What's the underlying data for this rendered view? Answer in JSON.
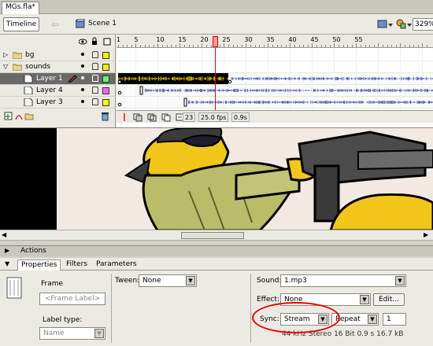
{
  "document_tab": "MGs.fla*",
  "toolbar": {
    "timeline_label": "Timeline",
    "scene_label": "Scene 1",
    "zoom": "329%"
  },
  "timeline": {
    "ruler_numbers": [
      "1",
      "5",
      "10",
      "15",
      "20",
      "25",
      "30",
      "35",
      "40",
      "45",
      "50",
      "55"
    ],
    "current_frame_marker": 23,
    "layers": [
      {
        "name": "bg",
        "type": "folder",
        "color": "#f2f200"
      },
      {
        "name": "sounds",
        "type": "folder",
        "color": "#f2f200"
      },
      {
        "name": "Layer 1",
        "type": "layer",
        "color": "#66ff66",
        "selected": true
      },
      {
        "name": "Layer 4",
        "type": "layer",
        "color": "#ff66ff"
      },
      {
        "name": "Layer 3",
        "type": "layer",
        "color": "#ffff00"
      }
    ],
    "status": {
      "current_frame": "23",
      "frame_rate": "25.0 fps",
      "elapsed": "0.9s"
    }
  },
  "panels": {
    "actions_label": "Actions",
    "tabs": [
      "Properties",
      "Filters",
      "Parameters"
    ]
  },
  "properties": {
    "frame_label": "Frame",
    "frame_placeholder": "<Frame Label>",
    "label_type_label": "Label type:",
    "label_type_value": "Name",
    "tween_label": "Tween:",
    "tween_value": "None",
    "sound_label": "Sound:",
    "sound_value": "1.mp3",
    "effect_label": "Effect:",
    "effect_value": "None",
    "edit_button": "Edit...",
    "sync_label": "Sync:",
    "sync_value": "Stream",
    "repeat_value": "Repeat",
    "repeat_count": "1",
    "sound_info": "44 kHz Stereo 16 Bit 0.9 s 16.7 kB"
  }
}
